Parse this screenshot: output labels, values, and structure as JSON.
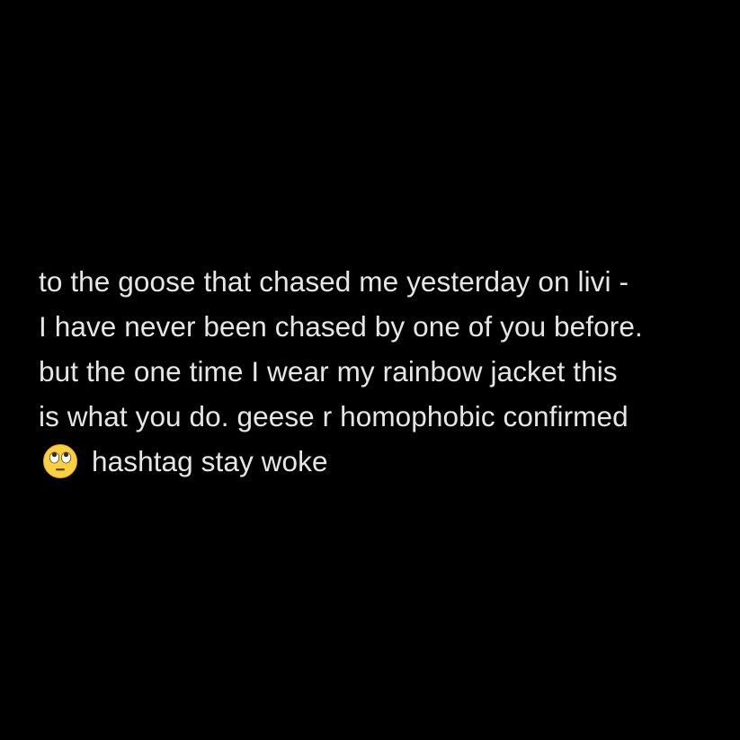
{
  "post": {
    "lines": [
      "to the goose that chased me yesterday on livi -",
      "I have never been chased by one of you before.",
      "but the one time I wear my rainbow jacket this",
      "is what you do. geese r homophobic confirmed"
    ],
    "last_line_text": "hashtag stay woke",
    "emoji": "face-with-rolling-eyes-icon"
  },
  "colors": {
    "background": "#000000",
    "text": "#e6e6e6",
    "emoji_face": "#f9cf44"
  }
}
